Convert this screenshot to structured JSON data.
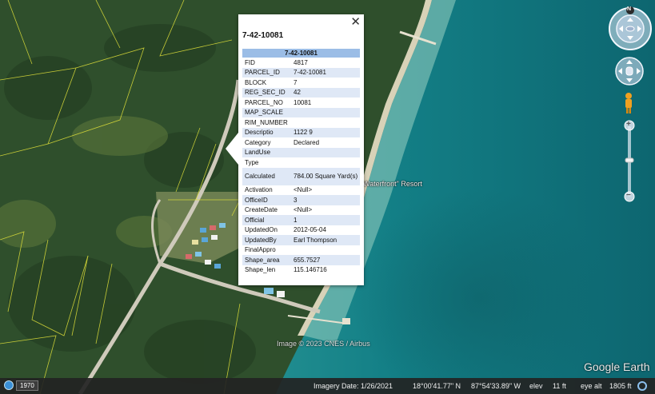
{
  "map": {
    "resort_label": "Waterfront\" Resort",
    "imagery_credit": "Image © 2023 CNES / Airbus",
    "brand": "Google Earth"
  },
  "balloon": {
    "title": "7-42-10081",
    "table_header": "7-42-10081",
    "rows": [
      {
        "key": "FID",
        "value": "4817"
      },
      {
        "key": "PARCEL_ID",
        "value": "7-42-10081"
      },
      {
        "key": "BLOCK",
        "value": "7"
      },
      {
        "key": "REG_SEC_ID",
        "value": "42"
      },
      {
        "key": "PARCEL_NO",
        "value": "10081"
      },
      {
        "key": "MAP_SCALE",
        "value": ""
      },
      {
        "key": "RIM_NUMBER",
        "value": ""
      },
      {
        "key": "Descriptio",
        "value": "1122 9"
      },
      {
        "key": "Category",
        "value": "Declared"
      },
      {
        "key": "LandUse",
        "value": ""
      },
      {
        "key": "Type",
        "value": ""
      },
      {
        "key": "Calculated",
        "value": "784.00 Square Yard(s)"
      },
      {
        "key": "Activation",
        "value": "<Null>"
      },
      {
        "key": "OfficeID",
        "value": "3"
      },
      {
        "key": "CreateDate",
        "value": "<Null>"
      },
      {
        "key": "Official",
        "value": "1"
      },
      {
        "key": "UpdatedOn",
        "value": "2012-05-04"
      },
      {
        "key": "UpdatedBy",
        "value": "Earl Thompson"
      },
      {
        "key": "FinalAppro",
        "value": ""
      },
      {
        "key": "Shape_area",
        "value": "655.7527"
      },
      {
        "key": "Shape_len",
        "value": "115.146716"
      }
    ],
    "close_glyph": "✕"
  },
  "nav": {
    "north_label": "N",
    "zoom_in": "+",
    "zoom_out": "−"
  },
  "statusbar": {
    "year": "1970",
    "imagery_date": "Imagery Date: 1/26/2021",
    "lat": "18°00'41.77\" N",
    "lon": "87°54'33.89\" W",
    "elev_label": "elev",
    "elev_value": "11 ft",
    "eye_alt_label": "eye alt",
    "eye_alt_value": "1805 ft"
  },
  "colors": {
    "table_header": "#9bbde6",
    "row_alt": "#dfe8f6",
    "parcel_line": "#e2e23a",
    "sea_deep": "#0e6e78",
    "sea_shallow": "#6fb9b0"
  },
  "icons": [
    "close-icon",
    "compass-icon",
    "look-icon",
    "pegman-icon",
    "zoom-slider",
    "globe-icon",
    "streaming-icon"
  ]
}
